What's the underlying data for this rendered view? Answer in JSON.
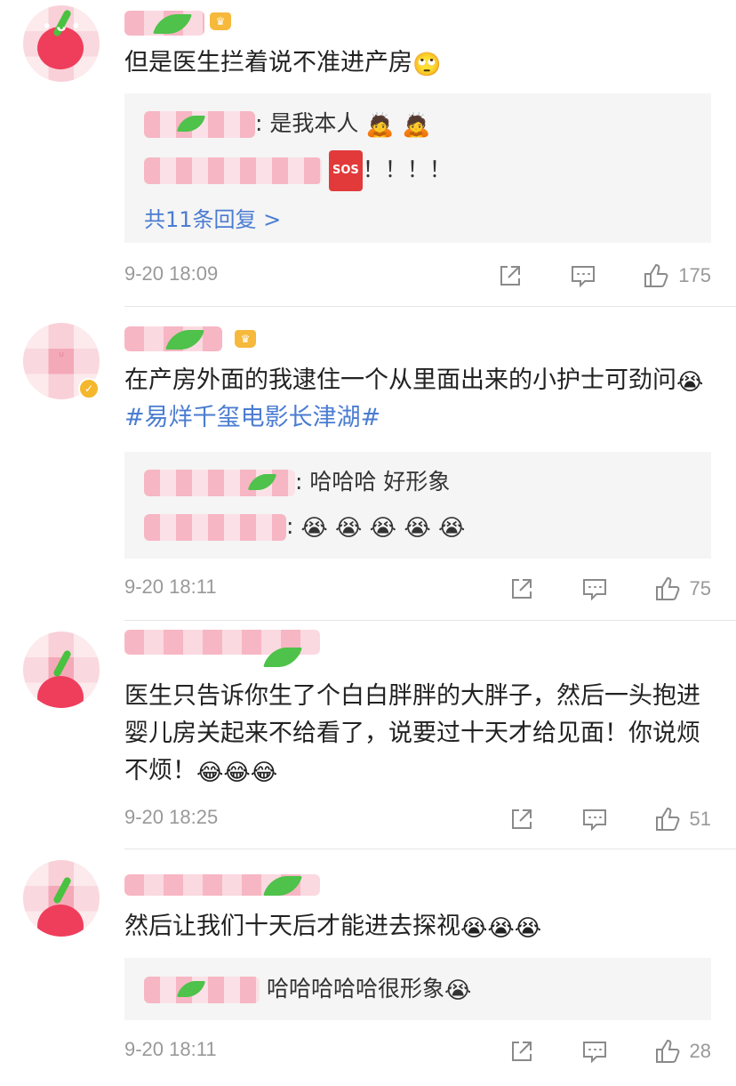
{
  "comments": [
    {
      "text": "但是医生拦着说不准进产房",
      "emoji_after": "🙄",
      "replies": [
        {
          "suffix": ": 是我本人",
          "emojis": "🙇 🙇"
        },
        {
          "suffix": "！！！！",
          "emojis": ""
        }
      ],
      "more_replies": "共11条回复 >",
      "time": "9-20 18:09",
      "likes": "175"
    },
    {
      "text": "在产房外面的我逮住一个从里面出来的小护士可劲问",
      "emoji_after": "😭",
      "hashtag": "#易烊千玺电影长津湖#",
      "replies": [
        {
          "suffix": ": 哈哈哈 好形象",
          "emojis": ""
        },
        {
          "suffix": ":",
          "emojis": "😭 😭 😭 😭 😭"
        }
      ],
      "time": "9-20 18:11",
      "likes": "75"
    },
    {
      "text": "医生只告诉你生了个白白胖胖的大胖子，然后一头抱进婴儿房关起来不给看了，说要过十天才给见面！你说烦不烦！",
      "emoji_after": "😂😂😂",
      "time": "9-20 18:25",
      "likes": "51"
    },
    {
      "text": "然后让我们十天后才能进去探视",
      "emoji_after": "😭😭😭",
      "replies": [
        {
          "suffix": "哈哈哈哈哈很形象",
          "emojis": "😭"
        }
      ],
      "time": "9-20 18:11",
      "likes": "28"
    }
  ],
  "colors": {
    "link": "#4a7cd1",
    "meta": "#999999",
    "reply_bg": "#f5f5f5"
  },
  "icons": {
    "share": "share-icon",
    "comment": "comment-icon",
    "like": "thumbs-up-icon"
  }
}
